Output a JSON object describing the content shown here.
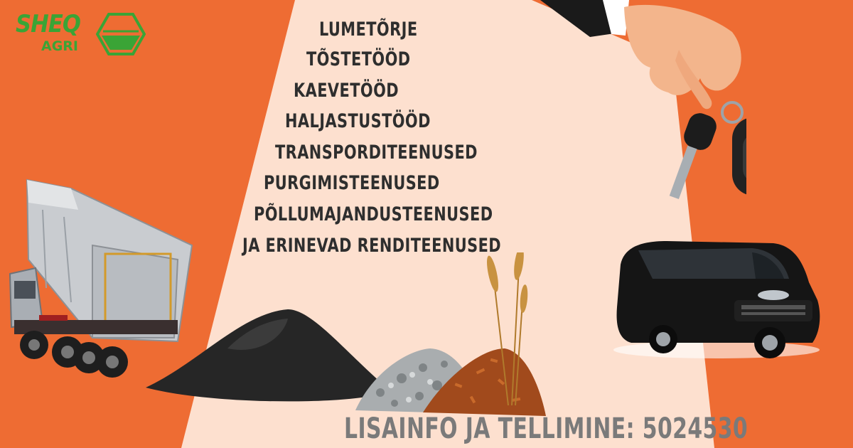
{
  "brand": {
    "logo_main": "SHEQ",
    "logo_sub": "AGRI"
  },
  "services": [
    "LUMETÕRJE",
    "TÕSTETÖÖD",
    "KAEVETÖÖD",
    "HALJASTUSTÖÖD",
    "TRANSPORDITEENUSED",
    "PURGIMISTEENUSED",
    "PÕLLUMAJANDUSTEENUSED",
    "JA ERINEVAD RENDITEENUSED"
  ],
  "contact": "LISAINFO JA TELLIMINE: 5024530",
  "colors": {
    "background": "#ee6c33",
    "panel": "#fde0cf",
    "text": "#2e2e2e",
    "contact_text": "#7a7a7a",
    "brand_green": "#3aa436"
  },
  "illustrations": [
    "tipper-truck-image",
    "soil-pile-image",
    "gravel-image",
    "wood-chips-image",
    "wheat-image",
    "hand-with-car-keys-image",
    "black-van-image"
  ]
}
